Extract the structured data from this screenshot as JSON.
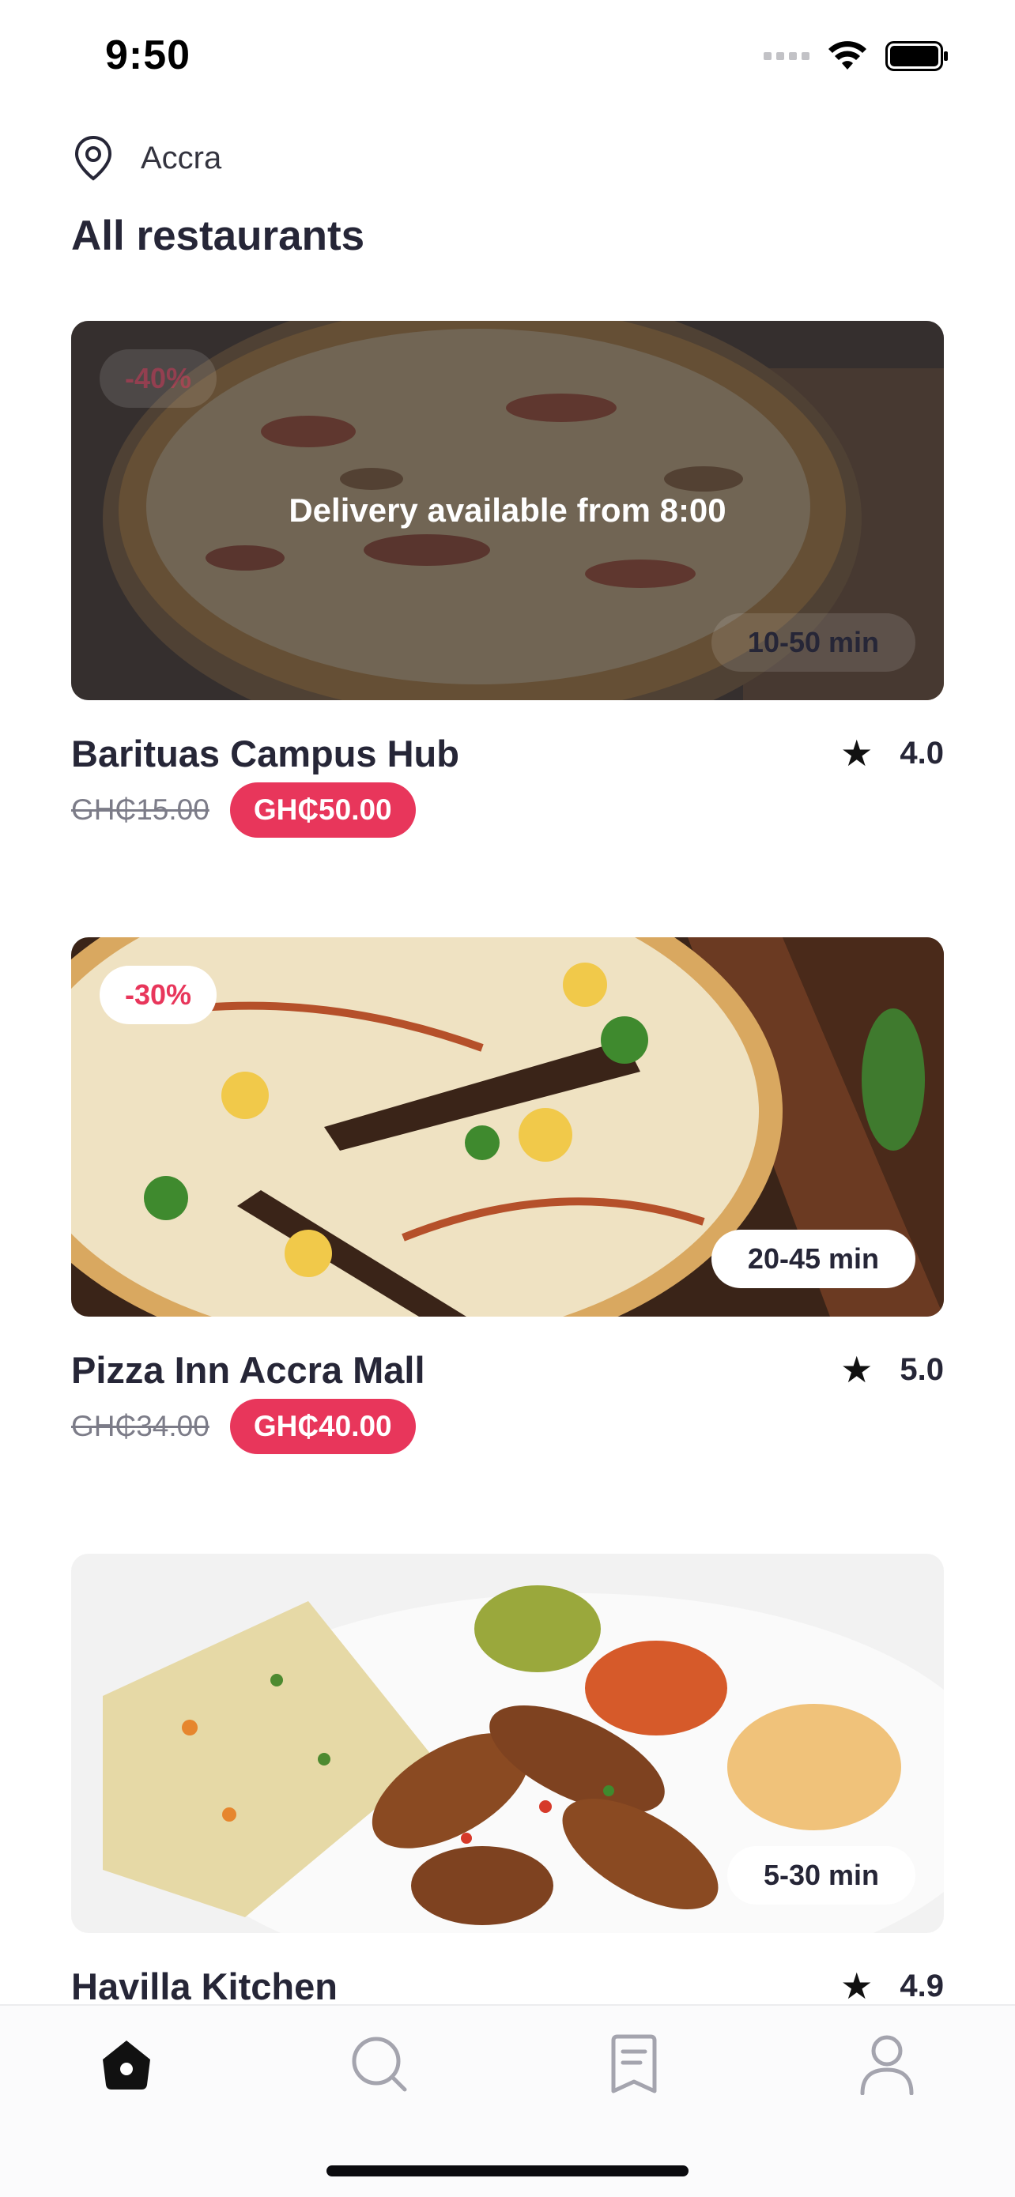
{
  "status_bar": {
    "time": "9:50"
  },
  "location": {
    "city": "Accra"
  },
  "page_title": "All restaurants",
  "restaurants": [
    {
      "name": "Barituas Campus Hub",
      "rating": "4.0",
      "old_price": "GH₵15.00",
      "price": "GH₵50.00",
      "discount": "-40%",
      "delivery_time": "10-50 min",
      "availability_note": "Delivery available from 8:00",
      "image": "pizza-photo"
    },
    {
      "name": "Pizza Inn Accra Mall",
      "rating": "5.0",
      "old_price": "GH₵34.00",
      "price": "GH₵40.00",
      "discount": "-30%",
      "delivery_time": "20-45 min",
      "image": "pizza-photo"
    },
    {
      "name": "Havilla Kitchen",
      "rating": "4.9",
      "delivery_time": "5-30 min",
      "image": "fried-rice-chicken-photo"
    }
  ],
  "tab_bar": {
    "items": [
      {
        "name": "home",
        "icon": "home-icon",
        "active": true
      },
      {
        "name": "search",
        "icon": "search-icon",
        "active": false
      },
      {
        "name": "orders",
        "icon": "receipt-icon",
        "active": false
      },
      {
        "name": "profile",
        "icon": "user-icon",
        "active": false
      }
    ]
  },
  "colors": {
    "accent": "#e8365b",
    "text": "#262637",
    "tab_active": "#111111",
    "tab_inactive": "#a4a4ae"
  }
}
